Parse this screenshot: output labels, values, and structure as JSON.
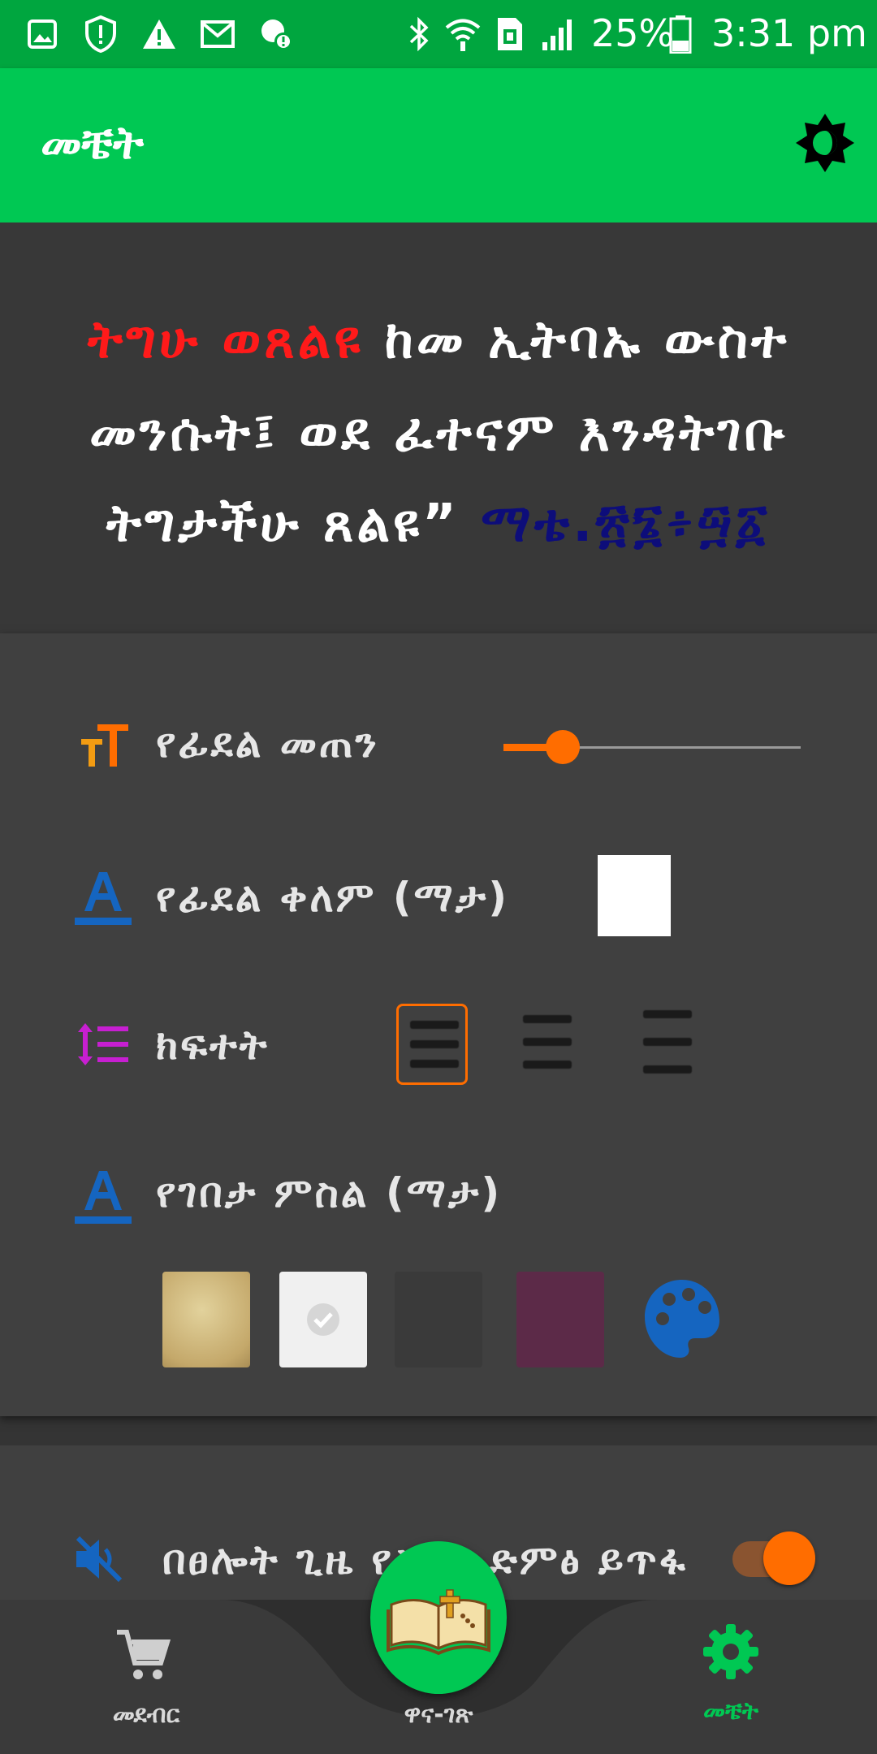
{
  "status_bar": {
    "battery": "25%",
    "time": "3:31 pm"
  },
  "app_bar": {
    "title": "መቼት"
  },
  "verse": {
    "line1_red": "ትግሁ ወጸልዩ",
    "line1_rest": " ከመ ኢትባኡ ውስተ",
    "line2": "መንሱት፤ ወደ ፈተናም እንዳትገቡ",
    "line3": "ትግታችሁ ጸልዩ”",
    "reference": " ማቴ.፳፮፥፵፩"
  },
  "settings": {
    "font_size_label": "የፊደል መጠን",
    "font_size_value": 0.2,
    "font_color_label": "የፊደል ቀለም (ማታ)",
    "spacing_label": "ክፍተት",
    "background_label": "የገበታ ምስል (ማታ)",
    "background_options": [
      "parchment",
      "white",
      "dark",
      "plum",
      "palette"
    ]
  },
  "sound": {
    "label": "በፀሎት ጊዜ የስልክ ድምፅ ይጥፋ",
    "enabled": true
  },
  "bottom_nav": {
    "store_label": "መደብር",
    "prayers_label": "ዋና-ገጽ",
    "settings_label": "መቼት"
  },
  "colors": {
    "accent": "#ff6d00",
    "primary": "#00c853",
    "status_bar": "#00a63f"
  }
}
